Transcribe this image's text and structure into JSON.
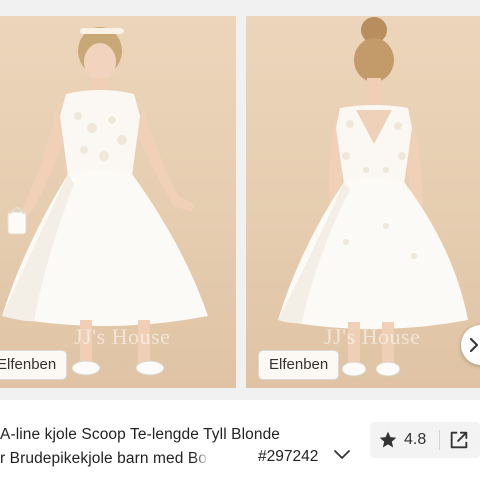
{
  "gallery": {
    "images": [
      {
        "watermark": "JJ's House",
        "color_tag": "Elfenben"
      },
      {
        "watermark": "JJ's House",
        "color_tag": "Elfenben"
      }
    ]
  },
  "product": {
    "title_line1": "A-line kjole Scoop Te-lengde Tyll Blonde",
    "title_line2_prefix": "r Brudepikekjole barn med ",
    "title_line2_faded": "Bo",
    "sku": "#297242"
  },
  "actions": {
    "rating": "4.8"
  },
  "icons": {
    "rating": "star-icon",
    "share": "share-icon",
    "expand": "chevron-down-icon",
    "next": "chevron-right-icon"
  },
  "colors": {
    "background": "#ffffff",
    "photo_backdrop": "#e8cfb3",
    "dress": "#fbf8f3",
    "text": "#222222",
    "action_bar": "#f3f3f3"
  }
}
